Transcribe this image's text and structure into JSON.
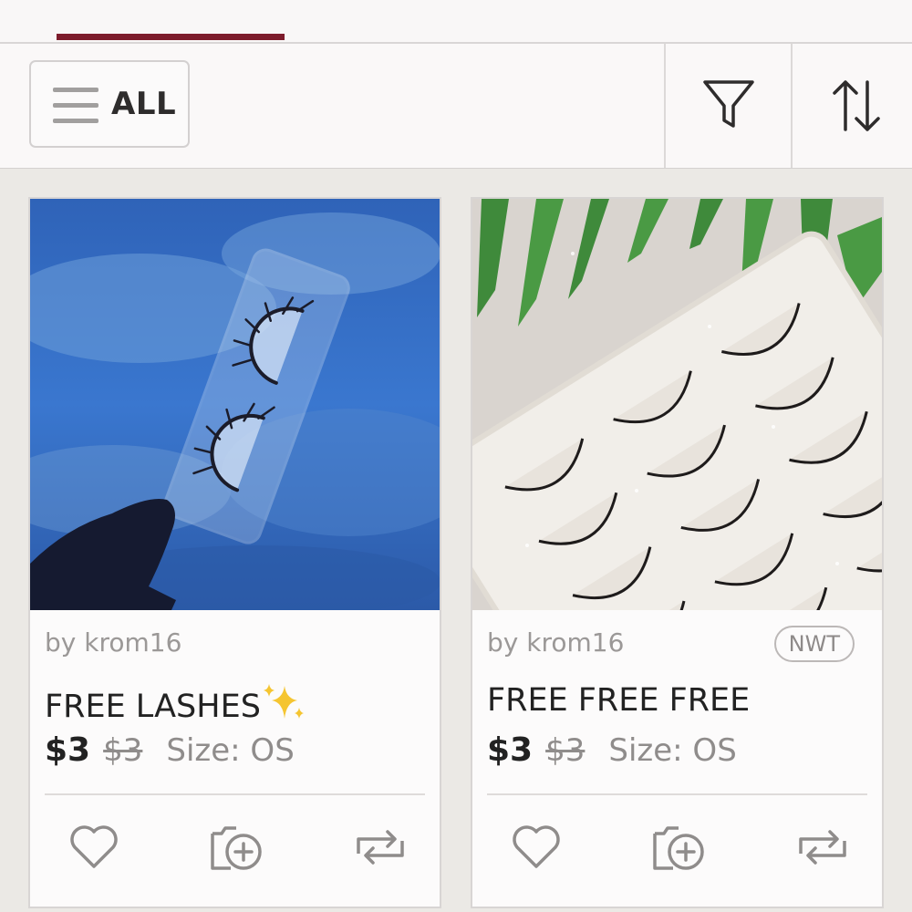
{
  "header": {
    "tabs": [
      {
        "label": "",
        "active": true
      },
      {
        "label": "",
        "active": false
      }
    ],
    "accent_color": "#7d1c2c"
  },
  "toolbar": {
    "all_label": "ALL",
    "menu_icon": "hamburger-icon",
    "filter_icon": "filter-icon",
    "sort_icon": "sort-icon"
  },
  "listings": [
    {
      "seller": "by krom16",
      "title": "FREE LASHES",
      "title_emoji": "sparkles",
      "badge": "",
      "price": "$3",
      "original_price": "$3",
      "size": "Size: OS",
      "actions": [
        "heart-icon",
        "bundle-add-icon",
        "share-icon"
      ]
    },
    {
      "seller": "by krom16",
      "title": "FREE FREE FREE",
      "title_emoji": "",
      "badge": "NWT",
      "price": "$3",
      "original_price": "$3",
      "size": "Size: OS",
      "actions": [
        "heart-icon",
        "bundle-add-icon",
        "share-icon"
      ]
    }
  ]
}
